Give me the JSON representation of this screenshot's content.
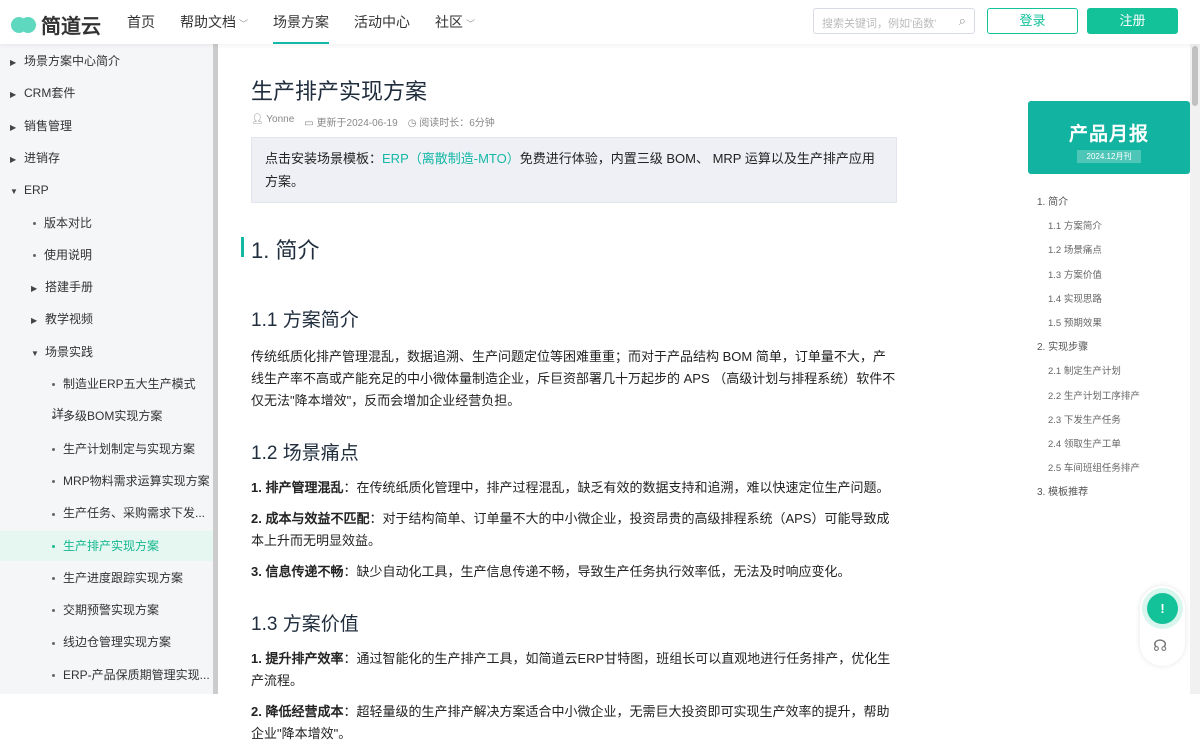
{
  "header": {
    "logo": "简道云",
    "nav": [
      {
        "label": "首页"
      },
      {
        "label": "帮助文档",
        "dropdown": true
      },
      {
        "label": "场景方案",
        "active": true
      },
      {
        "label": "活动中心"
      },
      {
        "label": "社区",
        "dropdown": true
      }
    ],
    "search_placeholder": "搜索关键词，例如'函数'",
    "login": "登录",
    "register": "注册"
  },
  "sidebar": {
    "items": [
      {
        "label": "场景方案中心简介",
        "type": "collapsed"
      },
      {
        "label": "CRM套件",
        "type": "collapsed"
      },
      {
        "label": "销售管理",
        "type": "collapsed"
      },
      {
        "label": "进销存",
        "type": "collapsed"
      },
      {
        "label": "ERP",
        "type": "expanded"
      },
      {
        "label": "版本对比",
        "type": "dot1"
      },
      {
        "label": "使用说明",
        "type": "dot1"
      },
      {
        "label": "搭建手册",
        "type": "collapsed1"
      },
      {
        "label": "教学视频",
        "type": "collapsed1"
      },
      {
        "label": "场景实践",
        "type": "expanded1"
      },
      {
        "label": "制造业ERP五大生产模式详...",
        "type": "dot2"
      },
      {
        "label": "多级BOM实现方案",
        "type": "dot2"
      },
      {
        "label": "生产计划制定与实现方案",
        "type": "dot2"
      },
      {
        "label": "MRP物料需求运算实现方案",
        "type": "dot2"
      },
      {
        "label": "生产任务、采购需求下发...",
        "type": "dot2"
      },
      {
        "label": "生产排产实现方案",
        "type": "dot2",
        "active": true
      },
      {
        "label": "生产进度跟踪实现方案",
        "type": "dot2"
      },
      {
        "label": "交期预警实现方案",
        "type": "dot2"
      },
      {
        "label": "线边仓管理实现方案",
        "type": "dot2"
      },
      {
        "label": "ERP-产品保质期管理实现...",
        "type": "dot2"
      }
    ]
  },
  "article": {
    "title": "生产排产实现方案",
    "author": "Yonne",
    "updated": "更新于2024-06-19",
    "read_time": "阅读时长：6分钟",
    "notice_prefix": "点击安装场景模板：",
    "notice_link": "ERP（离散制造-MTO）",
    "notice_suffix": "免费进行体验，内置三级 BOM、 MRP 运算以及生产排产应用方案。",
    "h_intro": "1. 简介",
    "h_1_1": "1.1 方案简介",
    "p_1_1": "传统纸质化排产管理混乱，数据追溯、生产问题定位等困难重重；而对于产品结构 BOM 简单，订单量不大，产线生产率不高或产能充足的中小微体量制造企业，斥巨资部署几十万起步的 APS （高级计划与排程系统）软件不仅无法\"降本增效\"，反而会增加企业经营负担。",
    "h_1_2": "1.2 场景痛点",
    "pain": [
      {
        "b": "1. 排产管理混乱",
        "t": "：在传统纸质化管理中，排产过程混乱，缺乏有效的数据支持和追溯，难以快速定位生产问题。"
      },
      {
        "b": "2. 成本与效益不匹配",
        "t": "：对于结构简单、订单量不大的中小微企业，投资昂贵的高级排程系统（APS）可能导致成本上升而无明显效益。"
      },
      {
        "b": "3. 信息传递不畅",
        "t": "：缺少自动化工具，生产信息传递不畅，导致生产任务执行效率低，无法及时响应变化。"
      }
    ],
    "h_1_3": "1.3 方案价值",
    "value": [
      {
        "b": "1. 提升排产效率",
        "t": "：通过智能化的生产排产工具，如简道云ERP甘特图，班组长可以直观地进行任务排产，优化生产流程。"
      },
      {
        "b": "2. 降低经营成本",
        "t": "：超轻量级的生产排产解决方案适合中小微企业，无需巨大投资即可实现生产效率的提升，帮助企业\"降本增效\"。"
      }
    ]
  },
  "banner": {
    "title": "产品月报",
    "subtitle": "2024.12月刊"
  },
  "toc": [
    {
      "label": "1. 简介"
    },
    {
      "label": "1.1 方案简介",
      "sub": true
    },
    {
      "label": "1.2 场景痛点",
      "sub": true
    },
    {
      "label": "1.3 方案价值",
      "sub": true
    },
    {
      "label": "1.4 实现思路",
      "sub": true
    },
    {
      "label": "1.5 预期效果",
      "sub": true
    },
    {
      "label": "2. 实现步骤"
    },
    {
      "label": "2.1 制定生产计划",
      "sub": true
    },
    {
      "label": "2.2 生产计划工序排产",
      "sub": true
    },
    {
      "label": "2.3 下发生产任务",
      "sub": true
    },
    {
      "label": "2.4 领取生产工单",
      "sub": true
    },
    {
      "label": "2.5 车间班组任务排产",
      "sub": true
    },
    {
      "label": "3. 模板推荐"
    }
  ]
}
